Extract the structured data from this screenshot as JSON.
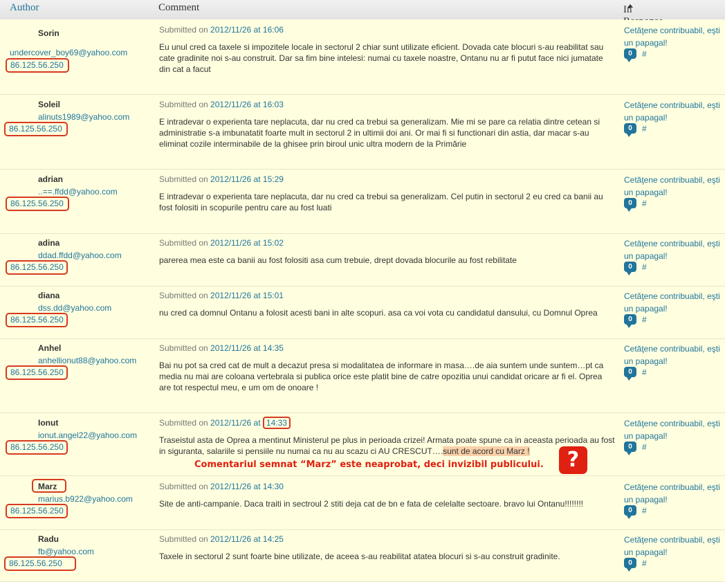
{
  "header": {
    "author": "Author",
    "comment": "Comment",
    "response": "In Response To"
  },
  "response_title": "Cetăţene contribuabil, eşti un papagal!",
  "bubble_count": "0",
  "hash": "#",
  "submitted_prefix": "Submitted on ",
  "note": "Comentariul semnat “Marz” este neaprobat, deci invizibil publicului.",
  "qmark": "?",
  "rows": [
    {
      "name": "Sorin",
      "email": "undercover_boy69@yahoo.com",
      "ip": "86.125.56.250",
      "date": "2012/11/26 at 16:06",
      "text": "Eu unul cred ca taxele si impozitele locale in sectorul 2 chiar sunt utilizate eficient. Dovada cate blocuri s-au reabilitat sau cate gradinite noi s-au construit. Dar sa fim bine intelesi: numai cu taxele noastre, Ontanu nu ar fi putut face nici jumatate din cat a facut"
    },
    {
      "name": "Soleil",
      "email": "alinuts1989@yahoo.com",
      "ip": "86.125.56.250",
      "date": "2012/11/26 at 16:03",
      "text": "E intradevar o experienta tare neplacuta, dar nu cred ca trebui sa generalizam. Mie mi se pare ca relatia dintre cetean si administratie s-a imbunatatit foarte mult in sectorul 2 in ultimii doi ani. Or mai fi si functionari din astia, dar macar s-au eliminat cozile interminabile de la ghisee prin biroul unic ultra modern de la Primărie"
    },
    {
      "name": "adrian",
      "email": "..==.ffdd@yahoo.com",
      "ip": "86.125.56.250",
      "date": "2012/11/26 at 15:29",
      "text": "E intradevar o experienta tare neplacuta, dar nu cred ca trebui sa generalizam. Cel putin in sectorul 2 eu cred ca banii au fost folositi in scopurile pentru care au fost luati"
    },
    {
      "name": "adina",
      "email": "ddad.ffdd@yahoo.com",
      "ip": "86.125.56.250",
      "date": "2012/11/26 at 15:02",
      "text": "parerea mea este ca banii au fost folositi asa cum trebuie, drept dovada blocurile au fost rebilitate"
    },
    {
      "name": "diana",
      "email": "dss.dd@yahoo.com",
      "ip": "86.125.56.250",
      "date": "2012/11/26 at 15:01",
      "text": "nu cred ca domnul Ontanu a folosit acesti bani in alte scopuri. asa ca voi vota cu candidatul dansului, cu Domnul Oprea"
    },
    {
      "name": "Anhel",
      "email": "anhellionut88@yahoo.com",
      "ip": "86.125.56.250",
      "date": "2012/11/26 at 14:35",
      "text": "Bai nu pot sa cred cat de mult a decazut presa si modalitatea de informare in masa….de aia suntem unde suntem…pt ca media nu mai are coloana vertebrala si publica orice este platit bine de catre opozitia unui candidat oricare ar fi el. Oprea are tot respectul meu, e um om de onoare !"
    },
    {
      "name": "Ionut",
      "email": "ionut.angel22@yahoo.com",
      "ip": "86.125.56.250",
      "date_prefix": "2012/11/26 at ",
      "time": "14:33",
      "text": "Traseistul asta de Oprea a mentinut Ministerul pe plus in perioada crizei! Armata poate spune ca in aceasta perioada au fost in siguranta, salariile si pensiile nu numai ca nu au scazu ci AU CRESCUT….",
      "highlight": "sunt de acord cu Marz !"
    },
    {
      "name": "Marz",
      "email": "marius.b922@yahoo.com",
      "ip": "86.125.56.250",
      "date": "2012/11/26 at 14:30",
      "text": "Site de anti-campanie. Daca traiti in sectroul 2 stiti deja cat de bn e fata de celelalte sectoare. bravo lui Ontanu!!!!!!!!"
    },
    {
      "name": "Radu",
      "email": "fb@yahoo.com",
      "ip": "86.125.56.250",
      "date": "2012/11/26 at 14:25",
      "text": "Taxele in sectorul 2 sunt foarte bine utilizate, de aceea s-au reabilitat atatea blocuri si s-au construit gradinite."
    }
  ]
}
